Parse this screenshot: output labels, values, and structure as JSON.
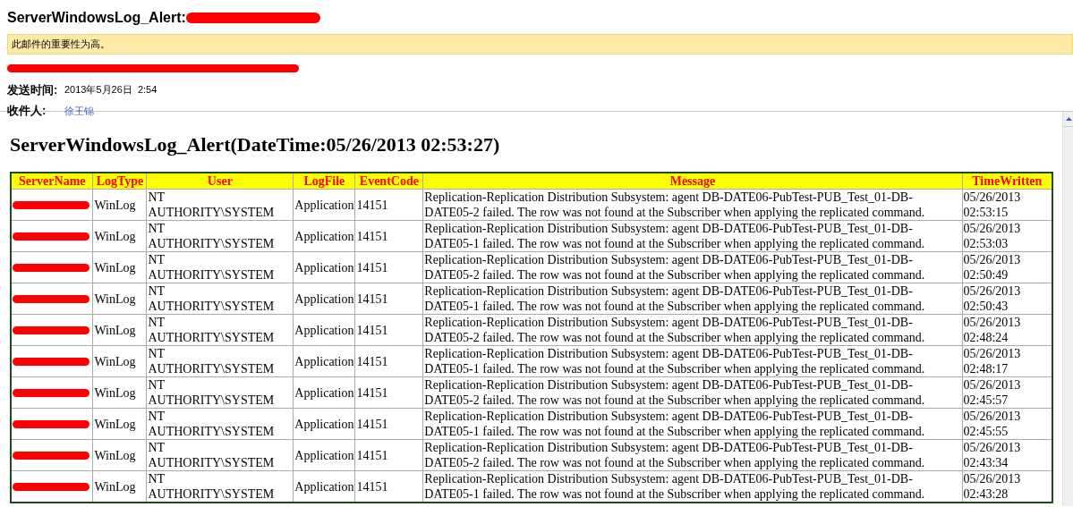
{
  "mail": {
    "subject": "ServerWindowsLog_Alert:",
    "importance_notice": "此邮件的重要性为高。",
    "sent_label": "发送时间:",
    "sent_value": "2013年5月26日  2:54",
    "to_label": "收件人:",
    "to_value": "徐王锦"
  },
  "report": {
    "heading": "ServerWindowsLog_Alert(DateTime:05/26/2013 02:53:27)",
    "table": {
      "columns": [
        "ServerName",
        "LogType",
        "User",
        "LogFile",
        "EventCode",
        "Message",
        "TimeWritten"
      ],
      "rows": [
        {
          "log_type": "WinLog",
          "user": "NT AUTHORITY\\SYSTEM",
          "log_file": "Application",
          "event_code": "14151",
          "message": "Replication-Replication Distribution Subsystem: agent DB-DATE06-PubTest-PUB_Test_01-DB-DATE05-2 failed. The row was not found at the Subscriber when applying the replicated command.",
          "time_written": "05/26/2013 02:53:15"
        },
        {
          "log_type": "WinLog",
          "user": "NT AUTHORITY\\SYSTEM",
          "log_file": "Application",
          "event_code": "14151",
          "message": "Replication-Replication Distribution Subsystem: agent DB-DATE06-PubTest-PUB_Test_01-DB-DATE05-1 failed. The row was not found at the Subscriber when applying the replicated command.",
          "time_written": "05/26/2013 02:53:03"
        },
        {
          "log_type": "WinLog",
          "user": "NT AUTHORITY\\SYSTEM",
          "log_file": "Application",
          "event_code": "14151",
          "message": "Replication-Replication Distribution Subsystem: agent DB-DATE06-PubTest-PUB_Test_01-DB-DATE05-2 failed. The row was not found at the Subscriber when applying the replicated command.",
          "time_written": "05/26/2013 02:50:49"
        },
        {
          "log_type": "WinLog",
          "user": "NT AUTHORITY\\SYSTEM",
          "log_file": "Application",
          "event_code": "14151",
          "message": "Replication-Replication Distribution Subsystem: agent DB-DATE06-PubTest-PUB_Test_01-DB-DATE05-1 failed. The row was not found at the Subscriber when applying the replicated command.",
          "time_written": "05/26/2013 02:50:43"
        },
        {
          "log_type": "WinLog",
          "user": "NT AUTHORITY\\SYSTEM",
          "log_file": "Application",
          "event_code": "14151",
          "message": "Replication-Replication Distribution Subsystem: agent DB-DATE06-PubTest-PUB_Test_01-DB-DATE05-2 failed. The row was not found at the Subscriber when applying the replicated command.",
          "time_written": "05/26/2013 02:48:24"
        },
        {
          "log_type": "WinLog",
          "user": "NT AUTHORITY\\SYSTEM",
          "log_file": "Application",
          "event_code": "14151",
          "message": "Replication-Replication Distribution Subsystem: agent DB-DATE06-PubTest-PUB_Test_01-DB-DATE05-1 failed. The row was not found at the Subscriber when applying the replicated command.",
          "time_written": "05/26/2013 02:48:17"
        },
        {
          "log_type": "WinLog",
          "user": "NT AUTHORITY\\SYSTEM",
          "log_file": "Application",
          "event_code": "14151",
          "message": "Replication-Replication Distribution Subsystem: agent DB-DATE06-PubTest-PUB_Test_01-DB-DATE05-2 failed. The row was not found at the Subscriber when applying the replicated command.",
          "time_written": "05/26/2013 02:45:57"
        },
        {
          "log_type": "WinLog",
          "user": "NT AUTHORITY\\SYSTEM",
          "log_file": "Application",
          "event_code": "14151",
          "message": "Replication-Replication Distribution Subsystem: agent DB-DATE06-PubTest-PUB_Test_01-DB-DATE05-1 failed. The row was not found at the Subscriber when applying the replicated command.",
          "time_written": "05/26/2013 02:45:55"
        },
        {
          "log_type": "WinLog",
          "user": "NT AUTHORITY\\SYSTEM",
          "log_file": "Application",
          "event_code": "14151",
          "message": "Replication-Replication Distribution Subsystem: agent DB-DATE06-PubTest-PUB_Test_01-DB-DATE05-2 failed. The row was not found at the Subscriber when applying the replicated command.",
          "time_written": "05/26/2013 02:43:34"
        },
        {
          "log_type": "WinLog",
          "user": "NT AUTHORITY\\SYSTEM",
          "log_file": "Application",
          "event_code": "14151",
          "message": "Replication-Replication Distribution Subsystem: agent DB-DATE06-PubTest-PUB_Test_01-DB-DATE05-1 failed. The row was not found at the Subscriber when applying the replicated command.",
          "time_written": "05/26/2013 02:43:28"
        }
      ]
    }
  }
}
